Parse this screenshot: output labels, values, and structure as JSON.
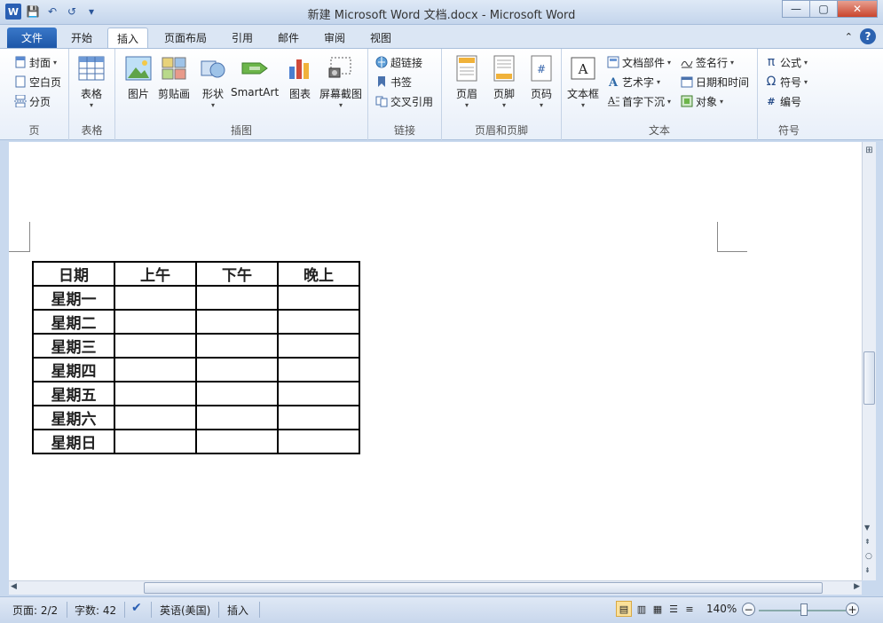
{
  "window": {
    "title": "新建 Microsoft Word 文档.docx  -  Microsoft Word",
    "app_icon": "W",
    "minimize": "—",
    "maximize": "▢",
    "close": "✕"
  },
  "quick_access": {
    "save": "💾",
    "undo": "↶",
    "redo": "↺",
    "more": "▾"
  },
  "tabs": [
    {
      "label": "文件"
    },
    {
      "label": "开始"
    },
    {
      "label": "插入"
    },
    {
      "label": "页面布局"
    },
    {
      "label": "引用"
    },
    {
      "label": "邮件"
    },
    {
      "label": "审阅"
    },
    {
      "label": "视图"
    }
  ],
  "help": "?",
  "ribbon": {
    "page": {
      "label": "页",
      "cover": "封面",
      "blank": "空白页",
      "break": "分页"
    },
    "table": {
      "label": "表格",
      "btn": "表格"
    },
    "illustrations": {
      "label": "插图",
      "picture": "图片",
      "clipart": "剪贴画",
      "shapes": "形状",
      "smartart": "SmartArt",
      "chart": "图表",
      "screenshot": "屏幕截图"
    },
    "links": {
      "label": "链接",
      "hyperlink": "超链接",
      "bookmark": "书签",
      "crossref": "交叉引用"
    },
    "header_footer": {
      "label": "页眉和页脚",
      "header": "页眉",
      "footer": "页脚",
      "page_number": "页码"
    },
    "text": {
      "label": "文本",
      "textbox": "文本框",
      "quickparts": "文档部件",
      "wordart": "艺术字",
      "dropcap": "首字下沉",
      "signature": "签名行",
      "datetime": "日期和时间",
      "object": "对象"
    },
    "symbols": {
      "label": "符号",
      "equation": "公式",
      "symbol": "符号",
      "numbering": "编号"
    }
  },
  "table": {
    "headers": [
      "日期",
      "上午",
      "下午",
      "晚上"
    ],
    "rows": [
      [
        "星期一",
        "",
        "",
        ""
      ],
      [
        "星期二",
        "",
        "",
        ""
      ],
      [
        "星期三",
        "",
        "",
        ""
      ],
      [
        "星期四",
        "",
        "",
        ""
      ],
      [
        "星期五",
        "",
        "",
        ""
      ],
      [
        "星期六",
        "",
        "",
        ""
      ],
      [
        "星期日",
        "",
        "",
        ""
      ]
    ]
  },
  "status": {
    "page": "页面: 2/2",
    "words": "字数: 42",
    "language": "英语(美国)",
    "mode": "插入",
    "zoom": "140%",
    "zoom_minus": "−",
    "zoom_plus": "+"
  }
}
